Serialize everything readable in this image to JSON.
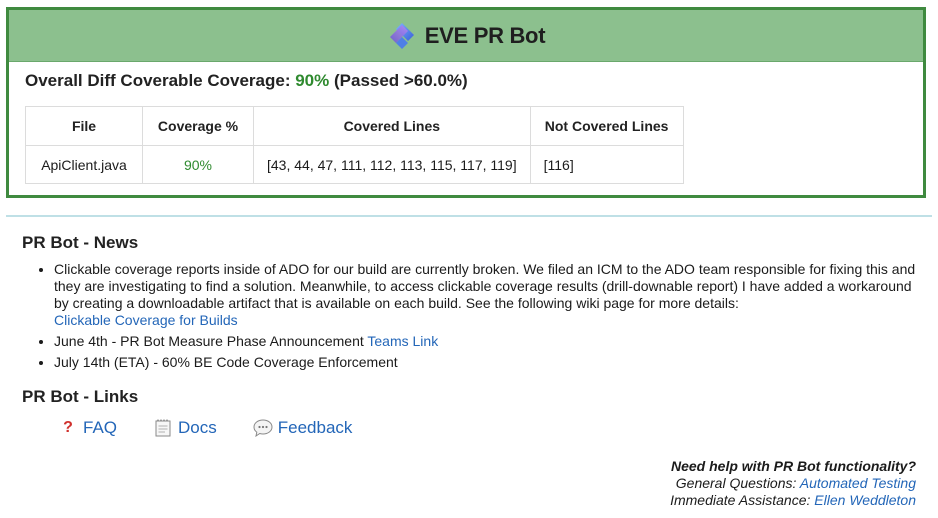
{
  "brand": {
    "name": "EVE PR Bot",
    "logo_icon": "eve-logo-icon"
  },
  "summary": {
    "label": "Overall Diff Coverable Coverage:",
    "percent": "90%",
    "status": "(Passed >60.0%)",
    "percent_color": "#2f8a2f"
  },
  "table": {
    "headers": [
      "File",
      "Coverage %",
      "Covered Lines",
      "Not Covered Lines"
    ],
    "rows": [
      {
        "file": "ApiClient.java",
        "coverage": "90%",
        "covered": "[43, 44, 47, 111, 112, 113, 115, 117, 119]",
        "not_covered": "[116]"
      }
    ]
  },
  "news": {
    "title": "PR Bot - News",
    "items": [
      {
        "text": "Clickable coverage reports inside of ADO for our build are currently broken. We filed an ICM to the ADO team responsible for fixing this and they are investigating to find a solution. Meanwhile, to access clickable coverage results (drill-downable report) I have added a workaround by creating a downloadable artifact that is available on each build. See the following wiki page for more details:",
        "link": "Clickable Coverage for Builds"
      },
      {
        "text": "June 4th - PR Bot Measure Phase Announcement",
        "link": "Teams Link"
      },
      {
        "text": "July 14th (ETA) - 60% BE Code Coverage Enforcement",
        "link": ""
      }
    ]
  },
  "links": {
    "title": "PR Bot - Links",
    "items": [
      {
        "label": "FAQ",
        "icon": "question-icon"
      },
      {
        "label": "Docs",
        "icon": "notepad-icon"
      },
      {
        "label": "Feedback",
        "icon": "speech-bubble-icon"
      }
    ]
  },
  "help": {
    "question": "Need help with PR Bot functionality?",
    "general_label": "General Questions:",
    "general_link": "Automated Testing",
    "immediate_label": "Immediate Assistance:",
    "immediate_link": "Ellen Weddleton"
  },
  "colors": {
    "header_bg": "#8cc08e",
    "border": "#3f8a3f",
    "link": "#2366b8",
    "divider": "#bfe0e6"
  }
}
